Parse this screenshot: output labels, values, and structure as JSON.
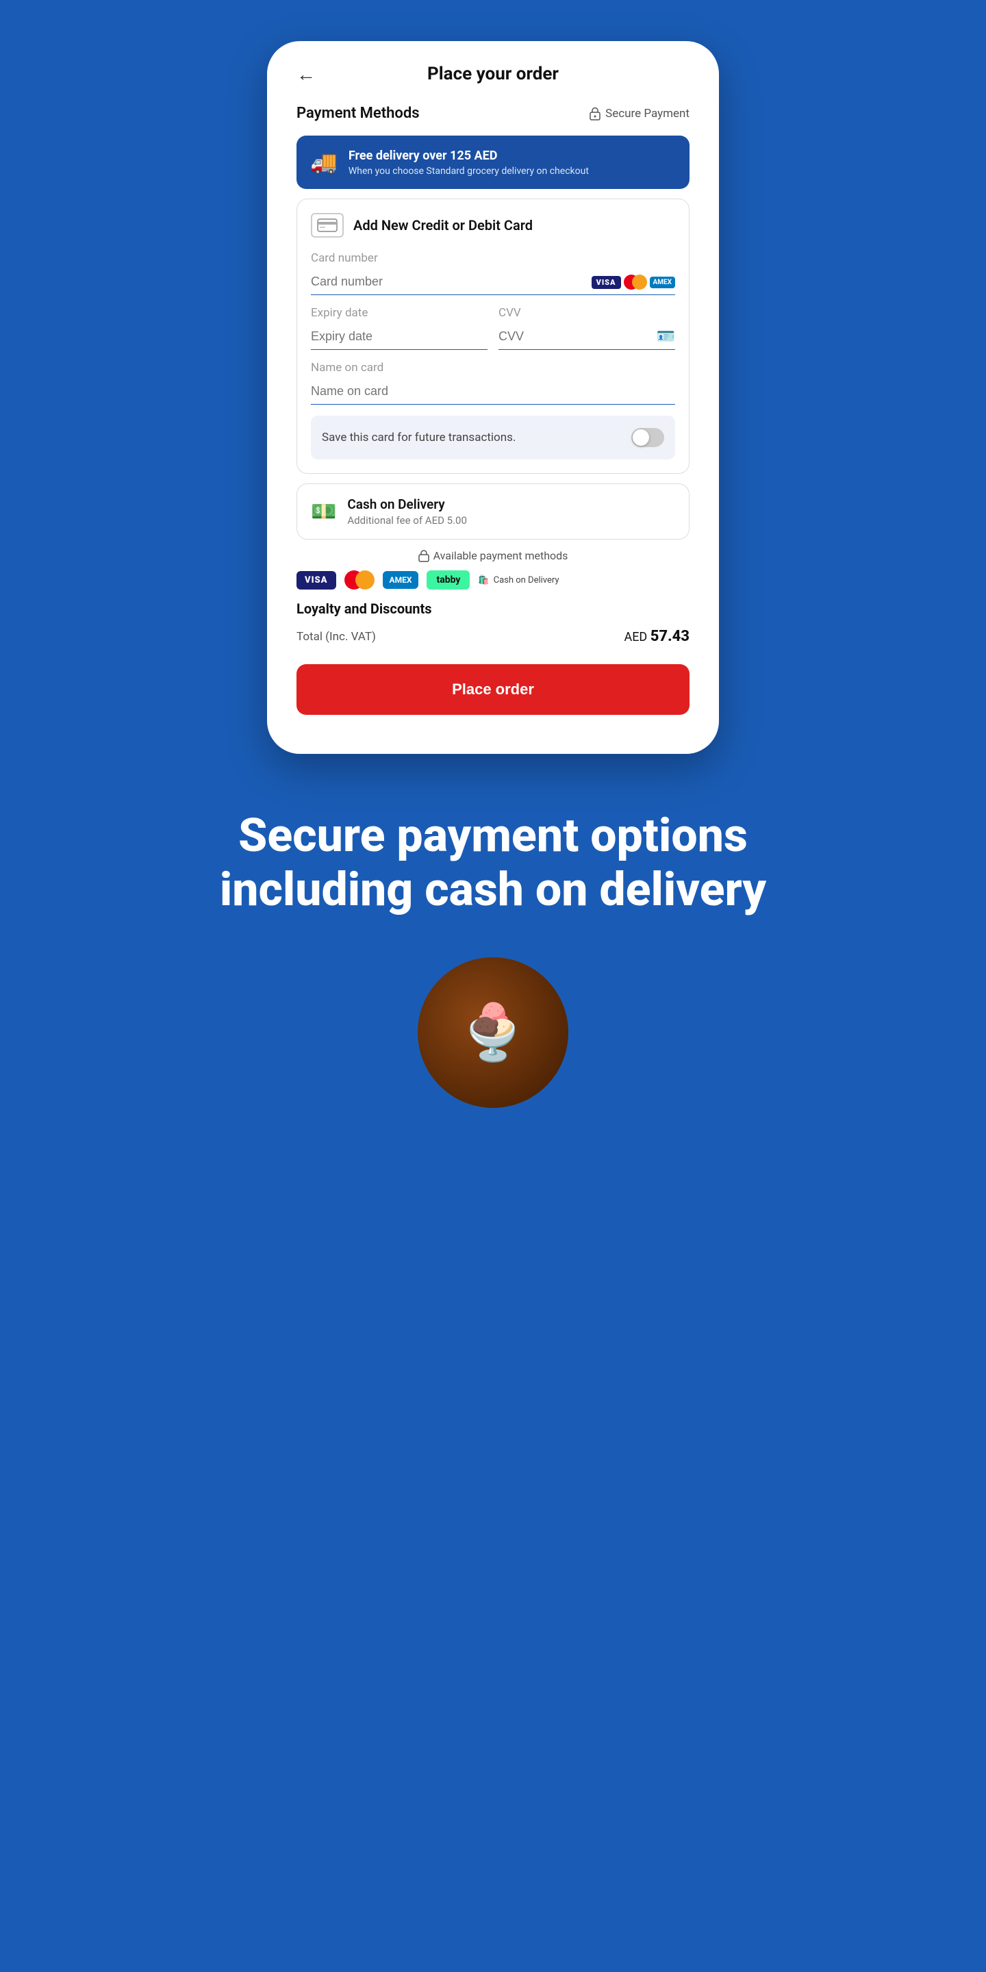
{
  "header": {
    "back_label": "←",
    "title": "Place your order"
  },
  "payment_methods": {
    "label": "Payment Methods",
    "secure_label": "Secure Payment"
  },
  "free_delivery": {
    "title": "Free delivery over 125 AED",
    "subtitle": "When you choose Standard grocery delivery on checkout"
  },
  "card_section": {
    "title": "Add New Credit or Debit Card",
    "card_number_label": "Card number",
    "card_number_value": "",
    "expiry_label": "Expiry date",
    "expiry_value": "",
    "cvv_label": "CVV",
    "cvv_value": "",
    "name_label": "Name on card",
    "name_value": "",
    "save_card_label": "Save this card for future transactions."
  },
  "cash_on_delivery": {
    "title": "Cash on Delivery",
    "subtitle": "Additional fee of AED 5.00"
  },
  "available_methods": {
    "label": "Available payment methods",
    "visa": "VISA",
    "amex": "AMEX",
    "tabby": "tabby",
    "cash": "Cash on Delivery"
  },
  "loyalty": {
    "title": "Loyalty and Discounts",
    "total_label": "Total (Inc. VAT)",
    "total_currency": "AED",
    "total_amount": "57.43"
  },
  "place_order_button": "Place order",
  "secure_headline": "Secure payment options including cash on delivery"
}
